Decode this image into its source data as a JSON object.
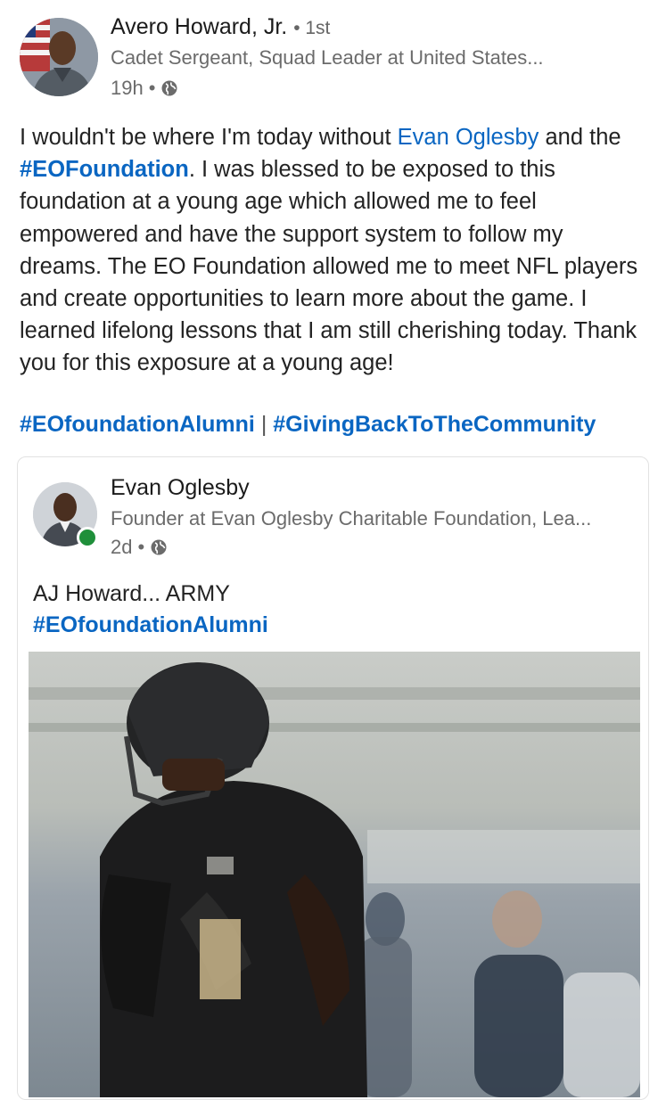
{
  "post": {
    "author": "Avero Howard, Jr.",
    "degree": "1st",
    "headline": "Cadet Sergeant, Squad Leader at United States...",
    "time": "19h",
    "body_1": "I wouldn't be where I'm today without ",
    "mention": "Evan Oglesby",
    "body_2": " and the ",
    "hashtag_1": "#EOFoundation",
    "body_3": ". I was blessed to be exposed to this foundation at a young age which allowed me to feel empowered and have the support system to follow my dreams. The EO Foundation allowed me to meet NFL players and create opportunities to learn more about the game. I learned lifelong lessons that I am still cherishing today. Thank you for this exposure at a young age!",
    "tag_alumni": "#EOfoundationAlumni",
    "tag_separator": "|",
    "tag_giving": "#GivingBackToTheCommunity"
  },
  "shared": {
    "author": "Evan Oglesby",
    "headline": "Founder at Evan Oglesby Charitable Foundation, Lea...",
    "time": "2d",
    "text": "AJ Howard... ARMY",
    "hashtag": "#EOfoundationAlumni"
  },
  "colors": {
    "link": "#0a66c2",
    "online": "#1f8f3a"
  },
  "icons": {
    "visibility": "globe-icon"
  }
}
